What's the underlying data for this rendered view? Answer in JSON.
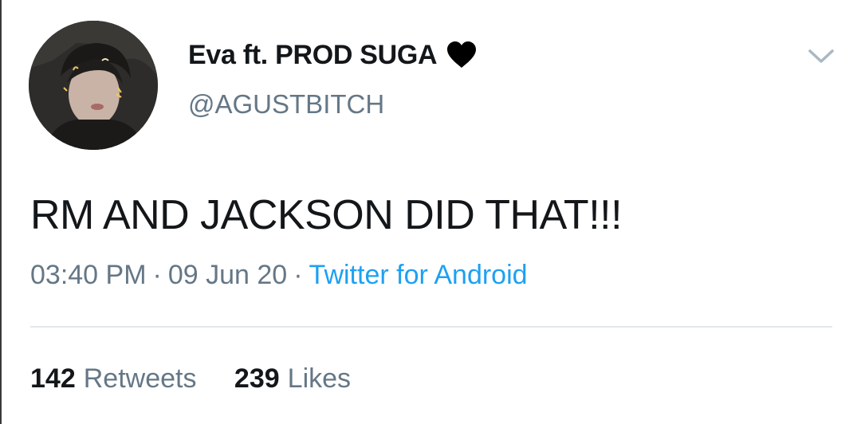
{
  "tweet": {
    "author": {
      "display_name": "Eva ft. PROD SUGA",
      "emoji_name": "black-heart-icon",
      "handle": "@AGUSTBITCH"
    },
    "text": "RM AND JACKSON DID THAT!!!",
    "timestamp": {
      "time": "03:40 PM",
      "separator": "·",
      "date": "09 Jun 20",
      "source": "Twitter for Android"
    },
    "stats": {
      "retweets": {
        "count": "142",
        "label": "Retweets"
      },
      "likes": {
        "count": "239",
        "label": "Likes"
      }
    }
  },
  "colors": {
    "text_primary": "#14171a",
    "text_secondary": "#657786",
    "link": "#1da1f2",
    "divider": "#e1e8ed",
    "caret": "#aab8c2"
  }
}
